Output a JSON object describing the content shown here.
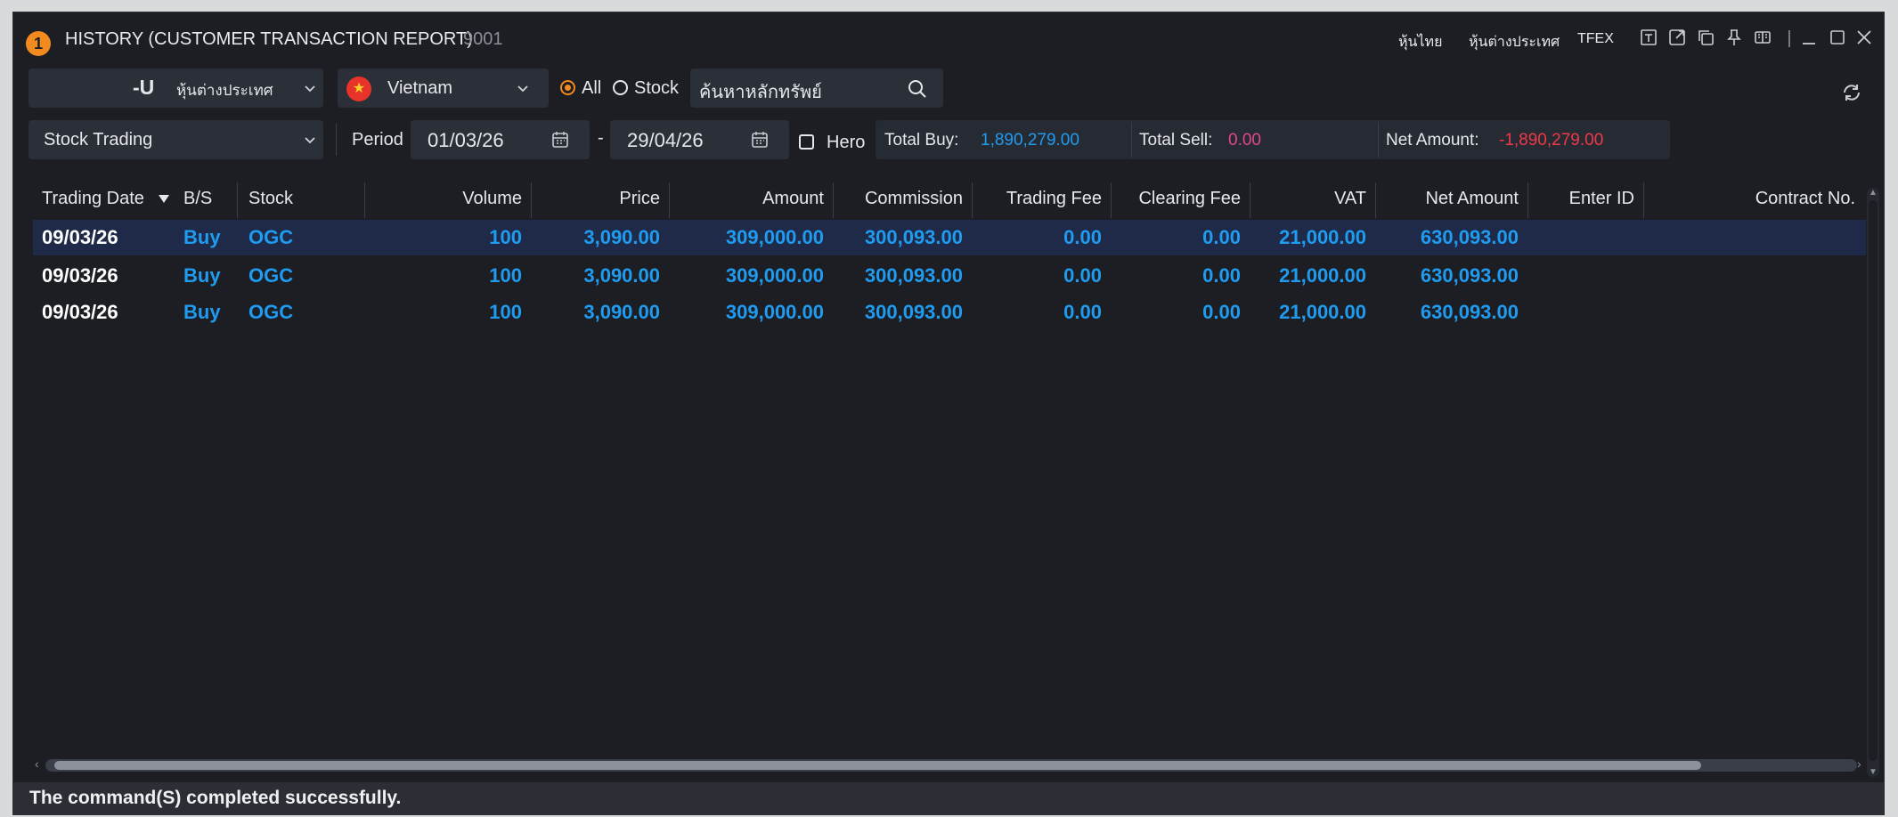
{
  "window": {
    "badge": "1",
    "title": "HISTORY (CUSTOMER TRANSACTION REPORT)",
    "code": "9001",
    "links": [
      "หุ้นไทย",
      "หุ้นต่างประเทศ",
      "TFEX"
    ]
  },
  "toolbar": {
    "account_prefix": "-U",
    "market": "หุ้นต่างประเทศ",
    "country": "Vietnam",
    "radio_all": "All",
    "radio_stock": "Stock",
    "search_value": "ค้นหาหลักทรัพย์",
    "category": "Stock Trading",
    "period_label": "Period",
    "date_from": "01/03/26",
    "date_sep": "-",
    "date_to": "29/04/26",
    "hero_label": "Hero",
    "total_buy_label": "Total Buy:",
    "total_buy": "1,890,279.00",
    "total_sell_label": "Total Sell:",
    "total_sell": "0.00",
    "net_amount_label": "Net Amount:",
    "net_amount": "-1,890,279.00"
  },
  "table": {
    "columns": [
      "Trading Date",
      "B/S",
      "Stock",
      "Volume",
      "Price",
      "Amount",
      "Commission",
      "Trading Fee",
      "Clearing Fee",
      "VAT",
      "Net Amount",
      "Enter ID",
      "Contract No."
    ],
    "rows": [
      [
        "09/03/26",
        "Buy",
        "OGC",
        "100",
        "3,090.00",
        "309,000.00",
        "300,093.00",
        "0.00",
        "0.00",
        "21,000.00",
        "630,093.00",
        "",
        ""
      ],
      [
        "09/03/26",
        "Buy",
        "OGC",
        "100",
        "3,090.00",
        "309,000.00",
        "300,093.00",
        "0.00",
        "0.00",
        "21,000.00",
        "630,093.00",
        "",
        ""
      ],
      [
        "09/03/26",
        "Buy",
        "OGC",
        "100",
        "3,090.00",
        "309,000.00",
        "300,093.00",
        "0.00",
        "0.00",
        "21,000.00",
        "630,093.00",
        "",
        ""
      ]
    ]
  },
  "status": "The command(S) completed successfully.",
  "colors": {
    "accent": "#f28a1f",
    "value_blue": "#1f9bf0",
    "sell_pink": "#e2488a",
    "negative_red": "#f0384a"
  }
}
